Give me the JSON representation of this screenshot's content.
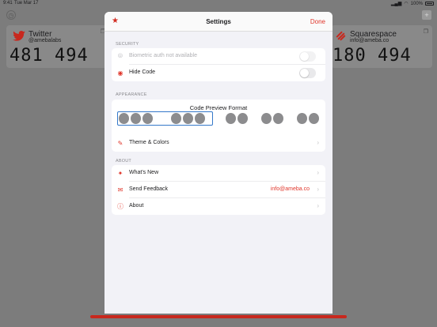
{
  "status_bar": {
    "time": "9:41",
    "date": "Tue Mar 17",
    "battery": "100%"
  },
  "background_cards": [
    {
      "name": "Twitter",
      "user": "@amebalabs",
      "code": "481 494"
    },
    {
      "name": "Squarespace",
      "user": "info@ameba.co",
      "code": "180 494"
    }
  ],
  "settings": {
    "title": "Settings",
    "done_label": "Done",
    "security_header": "SECURITY",
    "biometric_label": "Biometric auth not available",
    "hide_code_label": "Hide Code",
    "appearance_header": "APPEARANCE",
    "code_preview_title": "Code Preview Format",
    "theme_label": "Theme & Colors",
    "about_header": "ABOUT",
    "whats_new_label": "What's New",
    "send_feedback_label": "Send Feedback",
    "feedback_email": "info@ameba.co",
    "about_label": "About"
  },
  "colors": {
    "accent": "#e0362b",
    "selection": "#3478c9"
  }
}
